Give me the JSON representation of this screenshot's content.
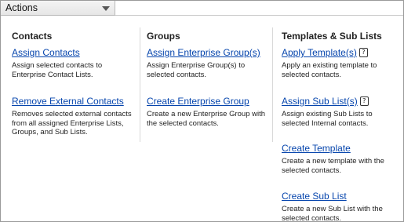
{
  "actions": {
    "label": "Actions",
    "arrow_icon": "chevron-down-icon"
  },
  "columns": [
    {
      "heading": "Contacts",
      "items": [
        {
          "link": "Assign Contacts",
          "description": "Assign selected contacts to Enterprise Contact Lists."
        },
        {
          "link": "Remove External Contacts",
          "description": "Removes selected external contacts from all assigned Enterprise Lists, Groups, and Sub Lists."
        }
      ]
    },
    {
      "heading": "Groups",
      "items": [
        {
          "link": "Assign Enterprise Group(s)",
          "description": "Assign Enterprise Group(s) to selected contacts."
        },
        {
          "link": "Create Enterprise Group",
          "description": "Create a new Enterprise Group with the selected contacts."
        }
      ]
    },
    {
      "heading": "Templates & Sub Lists",
      "items": [
        {
          "link": "Apply Template(s)",
          "description": "Apply an existing template to selected contacts.",
          "help_icon": "?"
        },
        {
          "link": "Assign Sub List(s)",
          "description": "Assign existing Sub Lists to selected Internal contacts.",
          "help_icon": "?"
        },
        {
          "link": "Create Template",
          "description": "Create a new template with the selected contacts."
        },
        {
          "link": "Create Sub List",
          "description": "Create a new Sub List with the selected contacts."
        }
      ]
    }
  ],
  "colors": {
    "link": "#0645ad",
    "text": "#222222",
    "border": "#9a9a9a"
  }
}
